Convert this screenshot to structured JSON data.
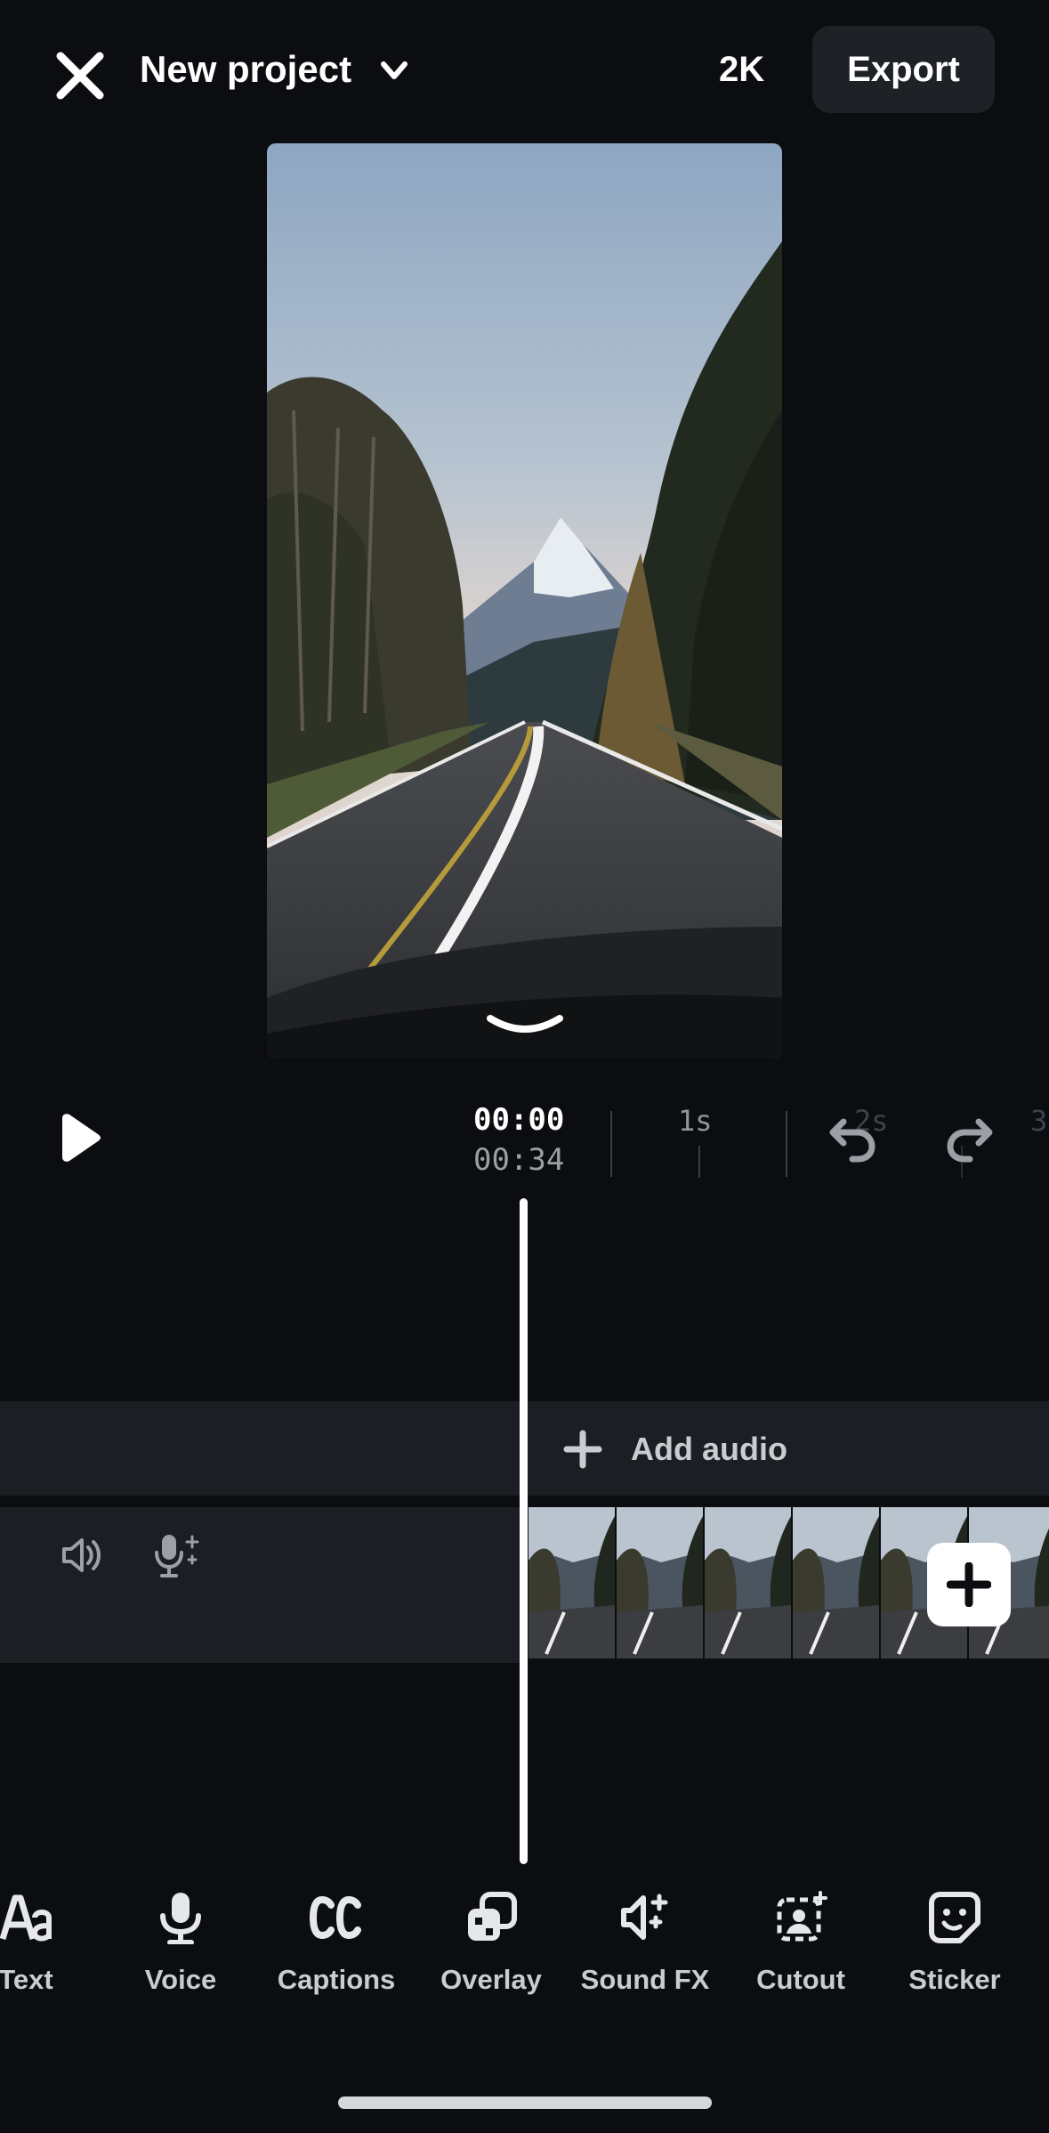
{
  "header": {
    "close_icon": "close-icon",
    "project_title": "New project",
    "resolution": "2K",
    "export_label": "Export"
  },
  "preview": {
    "description_icon": "collapse-chevron-icon"
  },
  "transport": {
    "current_time": "00:00",
    "total_time": "00:34",
    "ruler_labels": [
      "1s",
      "2s",
      "3"
    ]
  },
  "timeline": {
    "add_audio_label": "Add audio"
  },
  "toolbar": {
    "items": [
      {
        "label": "Text",
        "icon": "text-aa-icon"
      },
      {
        "label": "Voice",
        "icon": "microphone-icon"
      },
      {
        "label": "Captions",
        "icon": "captions-cc-icon"
      },
      {
        "label": "Overlay",
        "icon": "overlay-icon"
      },
      {
        "label": "Sound FX",
        "icon": "sound-fx-icon"
      },
      {
        "label": "Cutout",
        "icon": "cutout-icon"
      },
      {
        "label": "Sticker",
        "icon": "sticker-icon"
      }
    ]
  },
  "colors": {
    "background": "#0b0d10",
    "track": "#1b1e22",
    "button": "#1e2227",
    "text_secondary": "#9aa0a6"
  }
}
